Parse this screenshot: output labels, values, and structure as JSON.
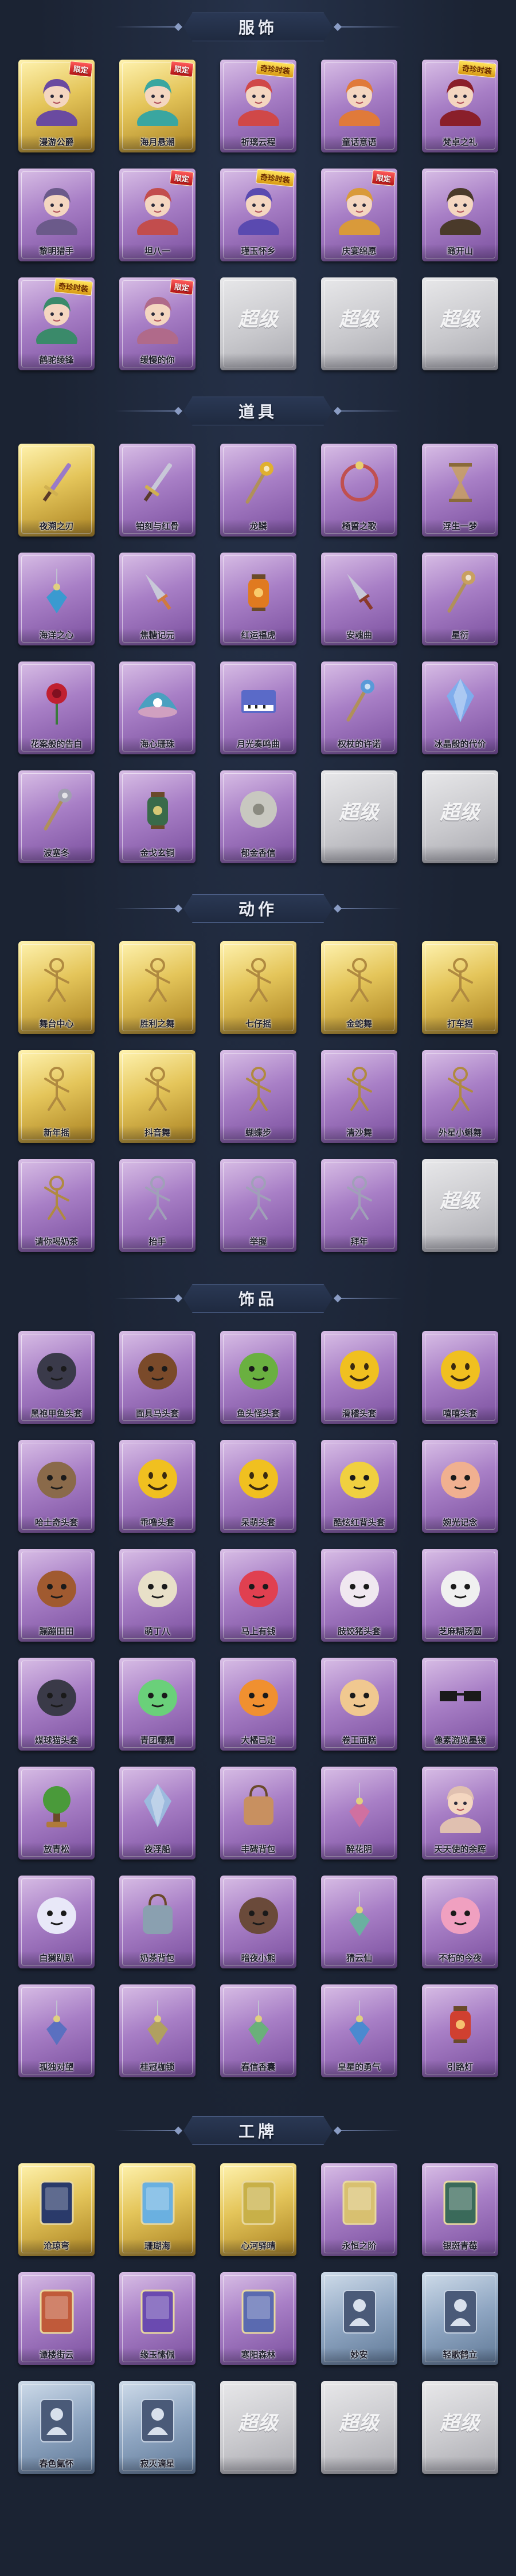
{
  "sections": [
    {
      "title": "服饰",
      "items": [
        {
          "label": "漫游公爵",
          "tone": "gold",
          "icon": "portrait-icon",
          "color": "#6a4aa0",
          "tag": "限定",
          "tag_style": "red"
        },
        {
          "label": "海月悬潮",
          "tone": "gold",
          "icon": "portrait-icon",
          "color": "#3aa6a0",
          "tag": "限定",
          "tag_style": "red"
        },
        {
          "label": "祈璃云程",
          "tone": "purple",
          "icon": "portrait-icon",
          "color": "#d04848",
          "tag": "奇珍时装",
          "tag_style": "yellow"
        },
        {
          "label": "童话意语",
          "tone": "purple",
          "icon": "portrait-icon",
          "color": "#e07a3a",
          "tag": "",
          "tag_style": ""
        },
        {
          "label": "梵卓之礼",
          "tone": "purple",
          "icon": "portrait-icon",
          "color": "#8a1f2a",
          "tag": "奇珍时装",
          "tag_style": "yellow"
        },
        {
          "label": "黎明猎手",
          "tone": "purple",
          "icon": "portrait-icon",
          "color": "#6b5a8a",
          "tag": "",
          "tag_style": ""
        },
        {
          "label": "坦八一",
          "tone": "purple",
          "icon": "portrait-icon",
          "color": "#c24d4d",
          "tag": "限定",
          "tag_style": "red"
        },
        {
          "label": "瑾玉怀乡",
          "tone": "purple",
          "icon": "portrait-icon",
          "color": "#5a4ab0",
          "tag": "奇珍时装",
          "tag_style": "yellow"
        },
        {
          "label": "庆宴绵愿",
          "tone": "purple",
          "icon": "portrait-icon",
          "color": "#d99a3a",
          "tag": "限定",
          "tag_style": "red"
        },
        {
          "label": "瞰开山",
          "tone": "purple",
          "icon": "portrait-icon",
          "color": "#4a3a2a",
          "tag": "",
          "tag_style": ""
        },
        {
          "label": "鹤驼绫锋",
          "tone": "purple",
          "icon": "portrait-icon",
          "color": "#3a8a6a",
          "tag": "奇珍时装",
          "tag_style": "yellow"
        },
        {
          "label": "缓慢的你",
          "tone": "purple",
          "icon": "portrait-icon",
          "color": "#b06a8a",
          "tag": "限定",
          "tag_style": "red"
        },
        {
          "label": "",
          "tone": "grey",
          "icon": "placeholder",
          "color": "",
          "tag": "",
          "tag_style": ""
        },
        {
          "label": "",
          "tone": "grey",
          "icon": "placeholder",
          "color": "",
          "tag": "",
          "tag_style": ""
        },
        {
          "label": "",
          "tone": "grey",
          "icon": "placeholder",
          "color": "",
          "tag": "",
          "tag_style": ""
        }
      ]
    },
    {
      "title": "道具",
      "items": [
        {
          "label": "夜溯之刃",
          "tone": "gold",
          "icon": "sword-icon",
          "color": "#9a7ac8",
          "tag": "",
          "tag_style": ""
        },
        {
          "label": "铂刻与红骨",
          "tone": "purple",
          "icon": "sword-icon",
          "color": "#c8c8d8",
          "tag": "",
          "tag_style": ""
        },
        {
          "label": "龙鳞",
          "tone": "purple",
          "icon": "scepter-icon",
          "color": "#e0b030",
          "tag": "",
          "tag_style": ""
        },
        {
          "label": "椅誓之歌",
          "tone": "purple",
          "icon": "ring-icon",
          "color": "#c05050",
          "tag": "",
          "tag_style": ""
        },
        {
          "label": "浮生一梦",
          "tone": "purple",
          "icon": "hourglass-icon",
          "color": "#c8a060",
          "tag": "",
          "tag_style": ""
        },
        {
          "label": "海洋之心",
          "tone": "purple",
          "icon": "pendant-icon",
          "color": "#3a9ad0",
          "tag": "",
          "tag_style": ""
        },
        {
          "label": "焦糖记元",
          "tone": "purple",
          "icon": "dagger-icon",
          "color": "#d07a40",
          "tag": "",
          "tag_style": ""
        },
        {
          "label": "红运福虎",
          "tone": "purple",
          "icon": "lantern-icon",
          "color": "#e07a20",
          "tag": "",
          "tag_style": ""
        },
        {
          "label": "安魂曲",
          "tone": "purple",
          "icon": "dagger-icon",
          "color": "#8a3a2a",
          "tag": "",
          "tag_style": ""
        },
        {
          "label": "星衍",
          "tone": "purple",
          "icon": "staff-icon",
          "color": "#c8a060",
          "tag": "",
          "tag_style": ""
        },
        {
          "label": "花案般的告白",
          "tone": "purple",
          "icon": "rose-icon",
          "color": "#c02030",
          "tag": "",
          "tag_style": ""
        },
        {
          "label": "海心珊珠",
          "tone": "purple",
          "icon": "shell-icon",
          "color": "#4aa0c0",
          "tag": "",
          "tag_style": ""
        },
        {
          "label": "月光奏鸣曲",
          "tone": "purple",
          "icon": "piano-icon",
          "color": "#5a6ac8",
          "tag": "",
          "tag_style": ""
        },
        {
          "label": "权杖的许诺",
          "tone": "purple",
          "icon": "scepter-icon",
          "color": "#5a9ad8",
          "tag": "",
          "tag_style": ""
        },
        {
          "label": "冰晶般的代价",
          "tone": "purple",
          "icon": "crystal-icon",
          "color": "#7ab0f0",
          "tag": "",
          "tag_style": ""
        },
        {
          "label": "波塞冬",
          "tone": "purple",
          "icon": "trident-icon",
          "color": "#a0a0b0",
          "tag": "",
          "tag_style": ""
        },
        {
          "label": "金戈玄铜",
          "tone": "purple",
          "icon": "lantern-icon",
          "color": "#3a6a4a",
          "tag": "",
          "tag_style": ""
        },
        {
          "label": "郁金香信",
          "tone": "purple",
          "icon": "disc-icon",
          "color": "#c8c8c0",
          "tag": "",
          "tag_style": ""
        },
        {
          "label": "",
          "tone": "grey",
          "icon": "placeholder",
          "color": "",
          "tag": "",
          "tag_style": ""
        },
        {
          "label": "",
          "tone": "grey",
          "icon": "placeholder",
          "color": "",
          "tag": "",
          "tag_style": ""
        }
      ]
    },
    {
      "title": "动作",
      "items": [
        {
          "label": "舞台中心",
          "tone": "gold",
          "icon": "pose-icon",
          "color": "#b08a40",
          "tag": "",
          "tag_style": ""
        },
        {
          "label": "胜利之舞",
          "tone": "gold",
          "icon": "pose-icon",
          "color": "#b08a40",
          "tag": "",
          "tag_style": ""
        },
        {
          "label": "七仔摇",
          "tone": "gold",
          "icon": "pose-icon",
          "color": "#b08a40",
          "tag": "",
          "tag_style": ""
        },
        {
          "label": "金蛇舞",
          "tone": "gold",
          "icon": "pose-icon",
          "color": "#b08a40",
          "tag": "",
          "tag_style": ""
        },
        {
          "label": "打车摇",
          "tone": "gold",
          "icon": "pose-icon",
          "color": "#b08a40",
          "tag": "",
          "tag_style": ""
        },
        {
          "label": "新年摇",
          "tone": "gold",
          "icon": "pose-icon",
          "color": "#b08a40",
          "tag": "",
          "tag_style": ""
        },
        {
          "label": "抖音舞",
          "tone": "gold",
          "icon": "pose-icon",
          "color": "#b08a40",
          "tag": "",
          "tag_style": ""
        },
        {
          "label": "蝴蝶步",
          "tone": "purple",
          "icon": "pose-icon",
          "color": "#b08a40",
          "tag": "",
          "tag_style": ""
        },
        {
          "label": "清沙舞",
          "tone": "purple",
          "icon": "pose-icon",
          "color": "#b08a40",
          "tag": "",
          "tag_style": ""
        },
        {
          "label": "外星小蝌舞",
          "tone": "purple",
          "icon": "pose-icon",
          "color": "#b08a40",
          "tag": "",
          "tag_style": ""
        },
        {
          "label": "请你喝奶茶",
          "tone": "purple",
          "icon": "pose-icon",
          "color": "#b08a40",
          "tag": "",
          "tag_style": ""
        },
        {
          "label": "抬手",
          "tone": "purple",
          "icon": "pose-icon",
          "color": "#a0a0b8",
          "tag": "",
          "tag_style": ""
        },
        {
          "label": "举握",
          "tone": "purple",
          "icon": "pose-icon",
          "color": "#a0a0b8",
          "tag": "",
          "tag_style": ""
        },
        {
          "label": "拜年",
          "tone": "purple",
          "icon": "pose-icon",
          "color": "#a0a0b8",
          "tag": "",
          "tag_style": ""
        },
        {
          "label": "",
          "tone": "grey",
          "icon": "placeholder",
          "color": "",
          "tag": "",
          "tag_style": ""
        }
      ]
    },
    {
      "title": "饰品",
      "items": [
        {
          "label": "黑袍甲鱼头套",
          "tone": "purple",
          "icon": "mask-icon",
          "color": "#3a3a4a",
          "tag": "",
          "tag_style": ""
        },
        {
          "label": "面具马头套",
          "tone": "purple",
          "icon": "mask-icon",
          "color": "#7a4a2a",
          "tag": "",
          "tag_style": ""
        },
        {
          "label": "鱼头怪头套",
          "tone": "purple",
          "icon": "mask-icon",
          "color": "#6ab040",
          "tag": "",
          "tag_style": ""
        },
        {
          "label": "滑稽头套",
          "tone": "purple",
          "icon": "smile-icon",
          "color": "#f0c020",
          "tag": "",
          "tag_style": ""
        },
        {
          "label": "嘻嘻头套",
          "tone": "purple",
          "icon": "smile-icon",
          "color": "#f0c020",
          "tag": "",
          "tag_style": ""
        },
        {
          "label": "哈士奇头套",
          "tone": "purple",
          "icon": "mask-icon",
          "color": "#8a6a4a",
          "tag": "",
          "tag_style": ""
        },
        {
          "label": "乖噜头套",
          "tone": "purple",
          "icon": "smile-icon",
          "color": "#f0c020",
          "tag": "",
          "tag_style": ""
        },
        {
          "label": "呆萌头套",
          "tone": "purple",
          "icon": "smile-icon",
          "color": "#f0c020",
          "tag": "",
          "tag_style": ""
        },
        {
          "label": "酷炫红背头套",
          "tone": "purple",
          "icon": "mask-icon",
          "color": "#f0d040",
          "tag": "",
          "tag_style": ""
        },
        {
          "label": "婉光记念",
          "tone": "purple",
          "icon": "mask-icon",
          "color": "#f0b090",
          "tag": "",
          "tag_style": ""
        },
        {
          "label": "蹦蹦田田",
          "tone": "purple",
          "icon": "mask-icon",
          "color": "#a05a30",
          "tag": "",
          "tag_style": ""
        },
        {
          "label": "萌丁八",
          "tone": "purple",
          "icon": "mask-icon",
          "color": "#e8e0c8",
          "tag": "",
          "tag_style": ""
        },
        {
          "label": "马上有钱",
          "tone": "purple",
          "icon": "mask-icon",
          "color": "#e04050",
          "tag": "",
          "tag_style": ""
        },
        {
          "label": "肢饺猪头套",
          "tone": "purple",
          "icon": "mask-icon",
          "color": "#f0e8f0",
          "tag": "",
          "tag_style": ""
        },
        {
          "label": "芝麻糊汤圆",
          "tone": "purple",
          "icon": "mask-icon",
          "color": "#f0f0f0",
          "tag": "",
          "tag_style": ""
        },
        {
          "label": "煤球猫头套",
          "tone": "purple",
          "icon": "mask-icon",
          "color": "#3a3a48",
          "tag": "",
          "tag_style": ""
        },
        {
          "label": "青团糯糯",
          "tone": "purple",
          "icon": "mask-icon",
          "color": "#6ad07a",
          "tag": "",
          "tag_style": ""
        },
        {
          "label": "大橘已定",
          "tone": "purple",
          "icon": "mask-icon",
          "color": "#f09030",
          "tag": "",
          "tag_style": ""
        },
        {
          "label": "卷王面糕",
          "tone": "purple",
          "icon": "mask-icon",
          "color": "#f0c890",
          "tag": "",
          "tag_style": ""
        },
        {
          "label": "像素游览墨镜",
          "tone": "purple",
          "icon": "glasses-icon",
          "color": "#1a1a1a",
          "tag": "",
          "tag_style": ""
        },
        {
          "label": "放青松",
          "tone": "purple",
          "icon": "tree-icon",
          "color": "#4a9a3a",
          "tag": "",
          "tag_style": ""
        },
        {
          "label": "夜浮船",
          "tone": "purple",
          "icon": "crystal-icon",
          "color": "#9ac0e0",
          "tag": "",
          "tag_style": ""
        },
        {
          "label": "丰碑背包",
          "tone": "purple",
          "icon": "bag-icon",
          "color": "#c89060",
          "tag": "",
          "tag_style": ""
        },
        {
          "label": "醉花阴",
          "tone": "purple",
          "icon": "pendant-icon",
          "color": "#d070a0",
          "tag": "",
          "tag_style": ""
        },
        {
          "label": "天天使的余晖",
          "tone": "purple",
          "icon": "portrait-icon",
          "color": "#e0c0b0",
          "tag": "",
          "tag_style": ""
        },
        {
          "label": "白獭趴趴",
          "tone": "purple",
          "icon": "mask-icon",
          "color": "#e8e8f8",
          "tag": "",
          "tag_style": ""
        },
        {
          "label": "奶茶背包",
          "tone": "purple",
          "icon": "bag-icon",
          "color": "#8aa0b0",
          "tag": "",
          "tag_style": ""
        },
        {
          "label": "暗夜小熊",
          "tone": "purple",
          "icon": "mask-icon",
          "color": "#6a4a3a",
          "tag": "",
          "tag_style": ""
        },
        {
          "label": "猜云仙",
          "tone": "purple",
          "icon": "pendant-icon",
          "color": "#6ab0a0",
          "tag": "",
          "tag_style": ""
        },
        {
          "label": "不朽的今夜",
          "tone": "purple",
          "icon": "mask-icon",
          "color": "#f0a0c0",
          "tag": "",
          "tag_style": ""
        },
        {
          "label": "孤独对望",
          "tone": "purple",
          "icon": "pendant-icon",
          "color": "#5a70c0",
          "tag": "",
          "tag_style": ""
        },
        {
          "label": "桂冠枷锁",
          "tone": "purple",
          "icon": "pendant-icon",
          "color": "#b0a060",
          "tag": "",
          "tag_style": ""
        },
        {
          "label": "春信香囊",
          "tone": "purple",
          "icon": "pendant-icon",
          "color": "#6ab07a",
          "tag": "",
          "tag_style": ""
        },
        {
          "label": "皇星的勇气",
          "tone": "purple",
          "icon": "pendant-icon",
          "color": "#4a8ad0",
          "tag": "",
          "tag_style": ""
        },
        {
          "label": "引路灯",
          "tone": "purple",
          "icon": "lantern-icon",
          "color": "#d04030",
          "tag": "",
          "tag_style": ""
        }
      ]
    },
    {
      "title": "工牌",
      "items": [
        {
          "label": "沧琼弯",
          "tone": "gold",
          "icon": "badge-icon",
          "color": "#2a3a6a",
          "tag": "",
          "tag_style": ""
        },
        {
          "label": "珊瑚海",
          "tone": "gold",
          "icon": "badge-icon",
          "color": "#6ab0e0",
          "tag": "",
          "tag_style": ""
        },
        {
          "label": "心河驿晴",
          "tone": "gold",
          "icon": "badge-icon",
          "color": "#c8b048",
          "tag": "",
          "tag_style": ""
        },
        {
          "label": "永恒之阶",
          "tone": "purple",
          "icon": "badge-icon",
          "color": "#d8c070",
          "tag": "",
          "tag_style": ""
        },
        {
          "label": "银斑青莓",
          "tone": "purple",
          "icon": "badge-icon",
          "color": "#3a6a5a",
          "tag": "",
          "tag_style": ""
        },
        {
          "label": "谭楼街云",
          "tone": "purple",
          "icon": "badge-icon",
          "color": "#c05a3a",
          "tag": "",
          "tag_style": ""
        },
        {
          "label": "缘玉愫佩",
          "tone": "purple",
          "icon": "badge-icon",
          "color": "#6a4ab0",
          "tag": "",
          "tag_style": ""
        },
        {
          "label": "寒阳森林",
          "tone": "purple",
          "icon": "badge-icon",
          "color": "#5a6ab0",
          "tag": "",
          "tag_style": ""
        },
        {
          "label": "妙安",
          "tone": "blue",
          "icon": "silhouette-icon",
          "color": "#d8e0ec",
          "tag": "",
          "tag_style": ""
        },
        {
          "label": "轻歌鹤立",
          "tone": "blue",
          "icon": "silhouette-icon",
          "color": "#d8e0ec",
          "tag": "",
          "tag_style": ""
        },
        {
          "label": "春色氤怀",
          "tone": "blue",
          "icon": "silhouette-icon",
          "color": "#d8e0ec",
          "tag": "",
          "tag_style": ""
        },
        {
          "label": "寂灭谪星",
          "tone": "blue",
          "icon": "silhouette-icon",
          "color": "#d8e0ec",
          "tag": "",
          "tag_style": ""
        },
        {
          "label": "",
          "tone": "grey",
          "icon": "placeholder",
          "color": "",
          "tag": "",
          "tag_style": ""
        },
        {
          "label": "",
          "tone": "grey",
          "icon": "placeholder",
          "color": "",
          "tag": "",
          "tag_style": ""
        },
        {
          "label": "",
          "tone": "grey",
          "icon": "placeholder",
          "color": "",
          "tag": "",
          "tag_style": ""
        }
      ]
    }
  ],
  "placeholder_text": "超级"
}
